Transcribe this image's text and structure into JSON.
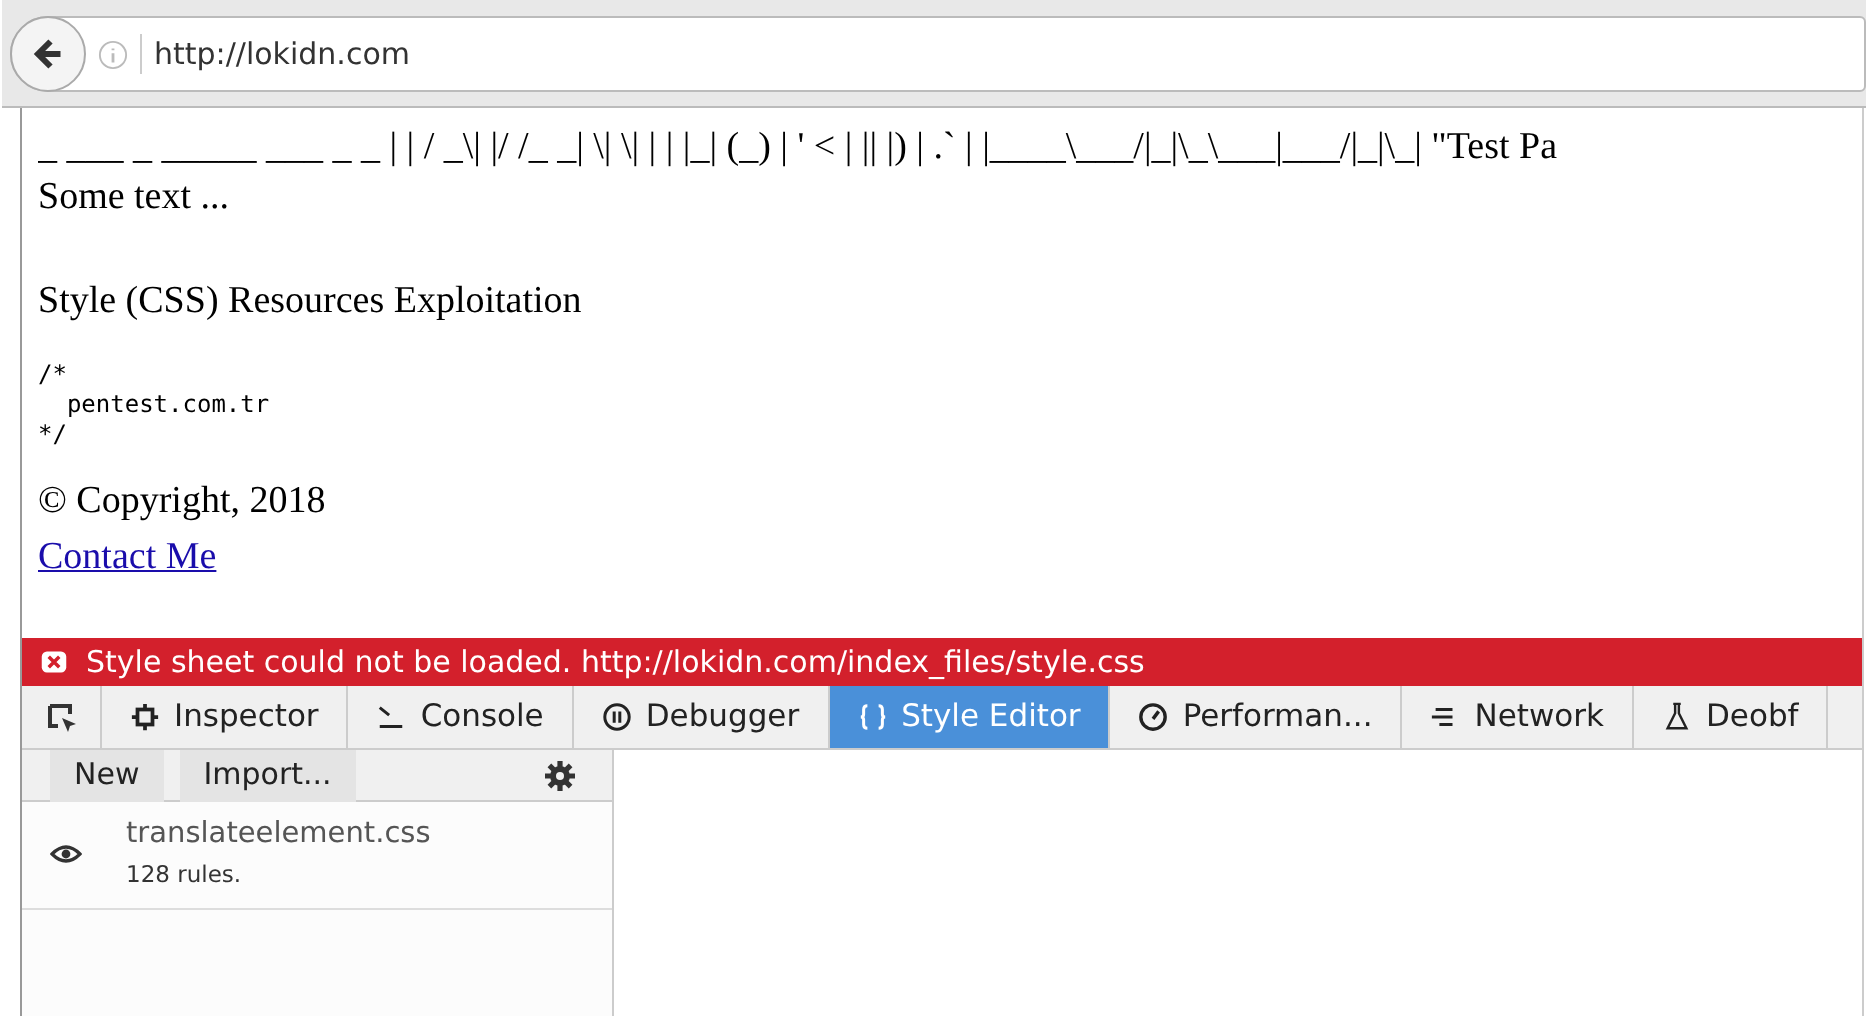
{
  "address_bar": {
    "url": "http://lokidn.com"
  },
  "page": {
    "ascii_banner": "_ ___ _ _____ ___ _ _ | | / _\\| |/ /_ _| \\| \\| | | |_| (_) | ' < | || |) | .` | |____\\___/|_|\\_\\___|___/|_|\\_| \"Test Pa",
    "text": "Some text ...",
    "heading": "Style (CSS) Resources Exploitation",
    "code": "/*\n  pentest.com.tr\n*/",
    "copyright": "© Copyright, 2018",
    "link": "Contact Me"
  },
  "error_bar": {
    "message": "Style sheet could not be loaded. http://lokidn.com/index_files/style.css"
  },
  "devtools_tabs": [
    {
      "label": "Inspector",
      "selected": false
    },
    {
      "label": "Console",
      "selected": false
    },
    {
      "label": "Debugger",
      "selected": false
    },
    {
      "label": "Style Editor",
      "selected": true
    },
    {
      "label": "Performan...",
      "selected": false
    },
    {
      "label": "Network",
      "selected": false
    },
    {
      "label": "Deobf",
      "selected": false
    }
  ],
  "style_sidebar": {
    "buttons": [
      "New",
      "Import..."
    ],
    "sheets": [
      {
        "name": "translateelement.css",
        "rules": "128 rules.",
        "visible": true
      }
    ]
  }
}
